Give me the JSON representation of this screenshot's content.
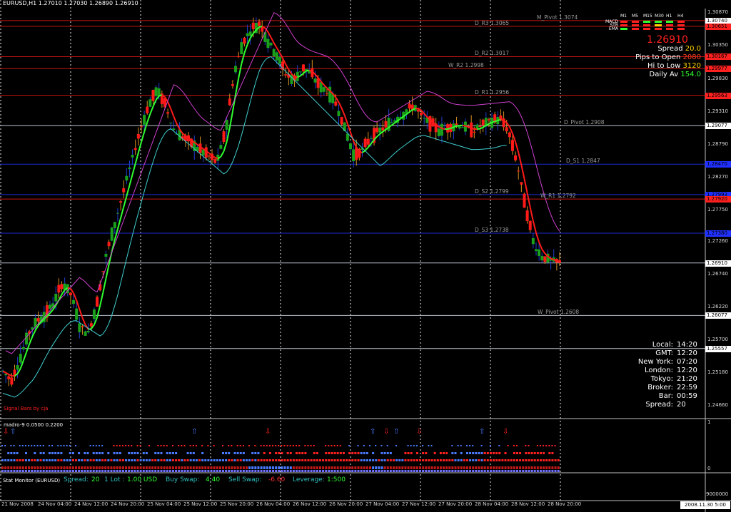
{
  "window": {
    "symbol_line": "EURUSD,H1  1.27010 1.27030 1.26890 1.26910"
  },
  "pivots": [
    {
      "label": "M_Pivot 1.3074",
      "value": 1.3074,
      "color": "#c81414"
    },
    {
      "label": "D_R3 1.3065",
      "value": 1.3065,
      "color": "#c81414"
    },
    {
      "label": "D_R2 1.3017",
      "value": 1.3017,
      "color": "#c81414"
    },
    {
      "label": "W_R2 1.2998",
      "value": 1.2998,
      "color": "#c81414"
    },
    {
      "label": "D_R1 1.2956",
      "value": 1.2956,
      "color": "#c81414"
    },
    {
      "label": "D_Pivot 1.2908",
      "value": 1.2908,
      "color": "#bcc4d0"
    },
    {
      "label": "D_S1 1.2847",
      "value": 1.2847,
      "color": "#1a2ccc"
    },
    {
      "label": "D_S2 1.2799",
      "value": 1.2799,
      "color": "#1a2ccc"
    },
    {
      "label": "W_R1 1.2792",
      "value": 1.2792,
      "color": "#c81414"
    },
    {
      "label": "D_S3 1.2738",
      "value": 1.2738,
      "color": "#1a2ccc"
    },
    {
      "label": "",
      "value": 1.2691,
      "color": "#bcc4d0"
    },
    {
      "label": "W_Pivot 1.2608",
      "value": 1.2608,
      "color": "#bcc4d0"
    },
    {
      "label": "",
      "value": 1.25557,
      "color": "#bcc4d0"
    }
  ],
  "price_tags": [
    {
      "text": "1.30740",
      "value": 1.3074,
      "bg": "#ffffff"
    },
    {
      "text": "1.30651",
      "value": 1.3065,
      "bg": "#ff2020"
    },
    {
      "text": "1.30167",
      "value": 1.3017,
      "bg": "#ff2020"
    },
    {
      "text": "1.29977",
      "value": 1.2998,
      "bg": "#ff2020"
    },
    {
      "text": "1.29563",
      "value": 1.2956,
      "bg": "#ff2020"
    },
    {
      "text": "1.29077",
      "value": 1.2908,
      "bg": "#ffffff"
    },
    {
      "text": "1.28470",
      "value": 1.2847,
      "bg": "#2030ff"
    },
    {
      "text": "1.27993",
      "value": 1.2799,
      "bg": "#2030ff"
    },
    {
      "text": "1.27920",
      "value": 1.2792,
      "bg": "#ff2020"
    },
    {
      "text": "1.27380",
      "value": 1.2738,
      "bg": "#2030ff"
    },
    {
      "text": "1.26910",
      "value": 1.2691,
      "bg": "#ffffff"
    },
    {
      "text": "1.26077",
      "value": 1.2608,
      "bg": "#ffffff"
    },
    {
      "text": "1.25557",
      "value": 1.25557,
      "bg": "#ffffff"
    }
  ],
  "y_axis": [
    "1.30870",
    "1.30350",
    "1.29830",
    "1.29310",
    "1.28790",
    "1.28270",
    "1.27750",
    "1.27260",
    "1.26740",
    "1.26220",
    "1.25700",
    "1.25180",
    "1.24660"
  ],
  "x_axis": [
    "21 Nov 2008",
    "24 Nov 04:00",
    "24 Nov 12:00",
    "24 Nov 20:00",
    "25 Nov 04:00",
    "25 Nov 12:00",
    "25 Nov 20:00",
    "26 Nov 04:00",
    "26 Nov 12:00",
    "26 Nov 20:00",
    "27 Nov 04:00",
    "27 Nov 12:00",
    "27 Nov 20:00",
    "28 Nov 04:00",
    "28 Nov 12:00",
    "28 Nov 20:00"
  ],
  "date_box": "2008.11.30 5:00",
  "info_panel": {
    "timeframes": [
      "M1",
      "M5",
      "M15",
      "M30",
      "H1",
      "H4"
    ],
    "indicators": [
      "MACD",
      "STR",
      "EMA"
    ],
    "price": "1.26910",
    "spread_label": "Spread",
    "spread_value": "20.0",
    "pips_label": "Pips to Open",
    "pips_value": "2080",
    "hilo_label": "Hi to Low",
    "hilo_value": "3120",
    "daily_label": "Daily Av",
    "daily_value": "154.0"
  },
  "clock": [
    {
      "k": "Local:",
      "v": "14:20"
    },
    {
      "k": "GMT:",
      "v": "12:20"
    },
    {
      "k": "New York:",
      "v": "07:20"
    },
    {
      "k": "London:",
      "v": "12:20"
    },
    {
      "k": "Tokyo:",
      "v": "21:20"
    },
    {
      "k": "Broker:",
      "v": "22:59"
    },
    {
      "k": "Bar:",
      "v": "00:59"
    },
    {
      "k": "Spread:",
      "v": "20"
    }
  ],
  "signal_label": "Signal Bars by cja",
  "sub_window": {
    "title": "madro-9 0.0500 0.2200",
    "y_labels": [
      "1",
      "0"
    ]
  },
  "stat_bar": {
    "title": "Stat Monitor (EURUSD)",
    "spread_label": "Spread:",
    "spread_value": "20",
    "lot_label": "1 Lot :",
    "lot_value": "1.00 USD",
    "buy_label": "Buy Swap:",
    "buy_value": "4.40",
    "sell_label": "Sell Swap:",
    "sell_value": "-6.60",
    "lev_label": "Leverage:",
    "lev_value": "1:500",
    "y_label": "9000000"
  },
  "chart_data": {
    "type": "candlestick",
    "symbol": "EURUSD",
    "timeframe": "H1",
    "ylim": [
      1.2445,
      1.3093
    ],
    "x_start": "21 Nov 2008",
    "x_end": "28 Nov 20:00",
    "close_series": [
      1.252,
      1.2505,
      1.254,
      1.258,
      1.26,
      1.261,
      1.263,
      1.266,
      1.264,
      1.259,
      1.258,
      1.263,
      1.27,
      1.275,
      1.28,
      1.285,
      1.29,
      1.294,
      1.2965,
      1.294,
      1.29,
      1.289,
      1.288,
      1.287,
      1.286,
      1.285,
      1.29,
      1.299,
      1.304,
      1.306,
      1.307,
      1.304,
      1.302,
      1.299,
      1.298,
      1.3,
      1.299,
      1.297,
      1.296,
      1.294,
      1.29,
      1.286,
      1.287,
      1.289,
      1.29,
      1.291,
      1.292,
      1.293,
      1.294,
      1.292,
      1.291,
      1.29,
      1.2905,
      1.291,
      1.2905,
      1.29,
      1.291,
      1.2915,
      1.292,
      1.29,
      1.285,
      1.278,
      1.272,
      1.27,
      1.2695,
      1.2691
    ]
  }
}
